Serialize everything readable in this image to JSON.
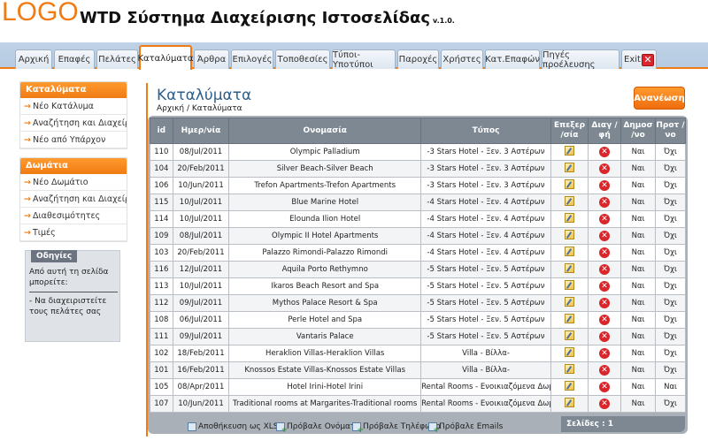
{
  "header": {
    "logo": "LOGO",
    "title": "WTD Σύστημα Διαχείρισης Ιστοσελίδας",
    "version": "v.1.0."
  },
  "tabs": [
    {
      "label": "Αρχική"
    },
    {
      "label": "Επαφές"
    },
    {
      "label": "Πελάτες"
    },
    {
      "label": "Καταλύματα",
      "active": true
    },
    {
      "label": "Άρθρα"
    },
    {
      "label": "Επιλογές"
    },
    {
      "label": "Τοποθεσίες"
    },
    {
      "label": "Τύποι-Υποτύποι"
    },
    {
      "label": "Παροχές"
    },
    {
      "label": "Χρήστες"
    },
    {
      "label": "Κατ.Επαφών"
    },
    {
      "label": "Πηγές προέλευσης"
    },
    {
      "label": "Exit"
    }
  ],
  "sidebar": {
    "accommodation": {
      "title": "Καταλύματα",
      "items": [
        "Νέο Κατάλυμα",
        "Αναζήτηση και Διαχείριση",
        "Νέο από Υπάρχον"
      ]
    },
    "rooms": {
      "title": "Δωμάτια",
      "items": [
        "Νέο Δωμάτιο",
        "Αναζήτηση και Διαχείριση",
        "Διαθεσιμότητες",
        "Τιμές"
      ]
    },
    "help": {
      "title": "Οδηγίες",
      "intro": "Από αυτή τη σελίδα μπορείτε:",
      "item": "- Να διαχειριστείτε τους πελάτες σας"
    }
  },
  "main": {
    "title": "Καταλύματα",
    "breadcrumb": "Αρχική / Καταλύματα",
    "refresh_label": "Ανανέωση",
    "columns": [
      "id",
      "Ημερ/νία",
      "Ονομασία",
      "Τύπος",
      "Επεξερ /σία",
      "Διαγ /φή",
      "Δημοσ /νο",
      "Προτ /νο"
    ],
    "rows": [
      {
        "id": "110",
        "date": "08/Jul/2011",
        "name": "Olympic Palladium",
        "type": "-3 Stars Hotel - Ξεν. 3 Αστέρων",
        "published": "Ναι",
        "featured": "Όχι"
      },
      {
        "id": "104",
        "date": "20/Feb/2011",
        "name": "Silver Beach-Silver Beach",
        "type": "-3 Stars Hotel - Ξεν. 3 Αστέρων",
        "published": "Ναι",
        "featured": "Όχι"
      },
      {
        "id": "106",
        "date": "10/Jun/2011",
        "name": "Trefon Apartments-Trefon Apartments",
        "type": "-3 Stars Hotel - Ξεν. 3 Αστέρων",
        "published": "Ναι",
        "featured": "Όχι"
      },
      {
        "id": "115",
        "date": "10/Jul/2011",
        "name": "Blue Marine Hotel",
        "type": "-4 Stars Hotel - Ξεν. 4 Αστέρων",
        "published": "Ναι",
        "featured": "Όχι"
      },
      {
        "id": "114",
        "date": "10/Jul/2011",
        "name": "Elounda Ilion Hotel",
        "type": "-4 Stars Hotel - Ξεν. 4 Αστέρων",
        "published": "Ναι",
        "featured": "Όχι"
      },
      {
        "id": "109",
        "date": "08/Jul/2011",
        "name": "Olympic II Hotel Apartments",
        "type": "-4 Stars Hotel - Ξεν. 4 Αστέρων",
        "published": "Ναι",
        "featured": "Όχι"
      },
      {
        "id": "103",
        "date": "20/Feb/2011",
        "name": "Palazzo Rimondi-Palazzo Rimondi",
        "type": "-4 Stars Hotel - Ξεν. 4 Αστέρων",
        "published": "Ναι",
        "featured": "Όχι"
      },
      {
        "id": "116",
        "date": "12/Jul/2011",
        "name": "Aquila Porto Rethymno",
        "type": "-5 Stars Hotel - Ξεν. 5 Αστέρων",
        "published": "Ναι",
        "featured": "Όχι"
      },
      {
        "id": "113",
        "date": "10/Jul/2011",
        "name": "Ikaros Beach Resort and Spa",
        "type": "-5 Stars Hotel - Ξεν. 5 Αστέρων",
        "published": "Ναι",
        "featured": "Όχι"
      },
      {
        "id": "112",
        "date": "09/Jul/2011",
        "name": "Mythos Palace Resort & Spa",
        "type": "-5 Stars Hotel - Ξεν. 5 Αστέρων",
        "published": "Ναι",
        "featured": "Όχι"
      },
      {
        "id": "108",
        "date": "06/Jul/2011",
        "name": "Perle Hotel and Spa",
        "type": "-5 Stars Hotel - Ξεν. 5 Αστέρων",
        "published": "Ναι",
        "featured": "Όχι"
      },
      {
        "id": "111",
        "date": "09/Jul/2011",
        "name": "Vantaris Palace",
        "type": "-5 Stars Hotel - Ξεν. 5 Αστέρων",
        "published": "Ναι",
        "featured": "Όχι"
      },
      {
        "id": "102",
        "date": "18/Feb/2011",
        "name": "Heraklion Villas-Heraklion Villas",
        "type": "Villa - Βίλλα-",
        "published": "Ναι",
        "featured": "Όχι"
      },
      {
        "id": "101",
        "date": "16/Feb/2011",
        "name": "Knossos Estate Villas-Knossos Estate Villas",
        "type": "Villa - Βίλλα-",
        "published": "Ναι",
        "featured": "Όχι"
      },
      {
        "id": "105",
        "date": "08/Apr/2011",
        "name": "Hotel Irini-Hotel Irini",
        "type": "Rental Rooms - Ενοικιαζόμενα Δωμάτια-",
        "published": "Ναι",
        "featured": "Ναι"
      },
      {
        "id": "107",
        "date": "10/Jun/2011",
        "name": "Traditional rooms at Margarites-Traditional rooms",
        "type": "Rental Rooms - Ενοικιαζόμενα Δωμάτια-",
        "published": "Ναι",
        "featured": "Όχι"
      }
    ],
    "pager": "Σελίδες : 1",
    "actions": [
      "Αποθήκευση ως XLS",
      "Πρόβαλε Ονόματα",
      "Πρόβαλε Τηλέφωνα",
      "Πρόβαλε Emails"
    ]
  }
}
